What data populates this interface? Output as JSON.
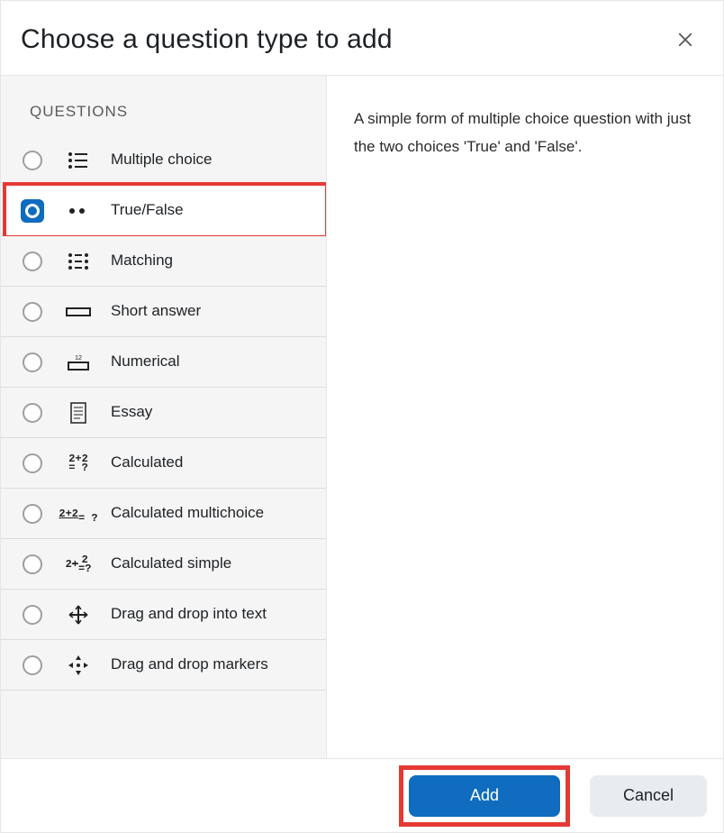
{
  "header": {
    "title": "Choose a question type to add"
  },
  "sidebar": {
    "section_label": "QUESTIONS",
    "items": [
      {
        "label": "Multiple choice"
      },
      {
        "label": "True/False"
      },
      {
        "label": "Matching"
      },
      {
        "label": "Short answer"
      },
      {
        "label": "Numerical"
      },
      {
        "label": "Essay"
      },
      {
        "label": "Calculated"
      },
      {
        "label": "Calculated multichoice"
      },
      {
        "label": "Calculated simple"
      },
      {
        "label": "Drag and drop into text"
      },
      {
        "label": "Drag and drop markers"
      }
    ],
    "selected_index": 1
  },
  "description": {
    "text": "A simple form of multiple choice question with just the two choices 'True' and 'False'."
  },
  "footer": {
    "add_label": "Add",
    "cancel_label": "Cancel"
  }
}
